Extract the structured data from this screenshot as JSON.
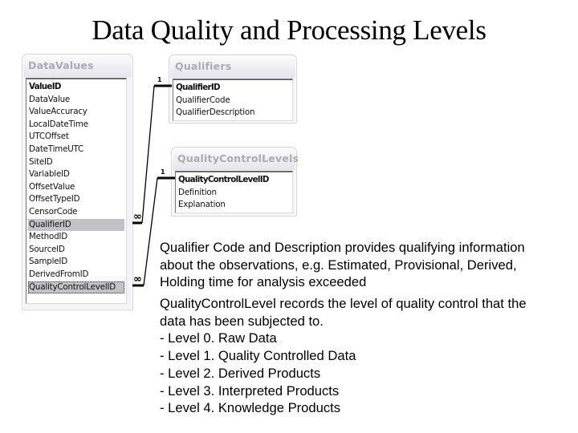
{
  "title": "Data Quality and Processing Levels",
  "tables": {
    "data_values": {
      "name": "DataValues",
      "fields": [
        {
          "label": "ValueID",
          "primary_key": true
        },
        {
          "label": "DataValue"
        },
        {
          "label": "ValueAccuracy"
        },
        {
          "label": "LocalDateTime"
        },
        {
          "label": "UTCOffset"
        },
        {
          "label": "DateTimeUTC"
        },
        {
          "label": "SiteID"
        },
        {
          "label": "VariableID"
        },
        {
          "label": "OffsetValue"
        },
        {
          "label": "OffsetTypeID"
        },
        {
          "label": "CensorCode"
        },
        {
          "label": "QualifierID",
          "selected": true
        },
        {
          "label": "MethodID"
        },
        {
          "label": "SourceID"
        },
        {
          "label": "SampleID"
        },
        {
          "label": "DerivedFromID"
        },
        {
          "label": "QualityControlLevelID",
          "selected": true,
          "focused": true
        }
      ]
    },
    "qualifiers": {
      "name": "Qualifiers",
      "fields": [
        {
          "label": "QualifierID",
          "primary_key": true
        },
        {
          "label": "QualifierCode"
        },
        {
          "label": "QualifierDescription"
        }
      ]
    },
    "quality_control_levels": {
      "name": "QualityControlLevels",
      "fields": [
        {
          "label": "QualityControlLevelID",
          "primary_key": true
        },
        {
          "label": "Definition"
        },
        {
          "label": "Explanation"
        }
      ]
    }
  },
  "relationships": [
    {
      "from": "DataValues.QualifierID",
      "to": "Qualifiers.QualifierID",
      "one_label": "1",
      "many_label": "∞"
    },
    {
      "from": "DataValues.QualityControlLevelID",
      "to": "QualityControlLevels.QualityControlLevelID",
      "one_label": "1",
      "many_label": "∞"
    }
  ],
  "notes": {
    "qualifier": [
      "Qualifier Code and Description provides qualifying information",
      "about the observations, e.g. Estimated, Provisional, Derived,",
      "Holding time for analysis exceeded"
    ],
    "qcl_intro": [
      "QualityControlLevel records the level of quality control that the",
      "data has been subjected to."
    ],
    "levels": [
      "- Level 0. Raw Data",
      "- Level 1. Quality Controlled Data",
      "- Level 2. Derived Products",
      "- Level 3. Interpreted Products",
      "- Level 4. Knowledge Products"
    ]
  }
}
